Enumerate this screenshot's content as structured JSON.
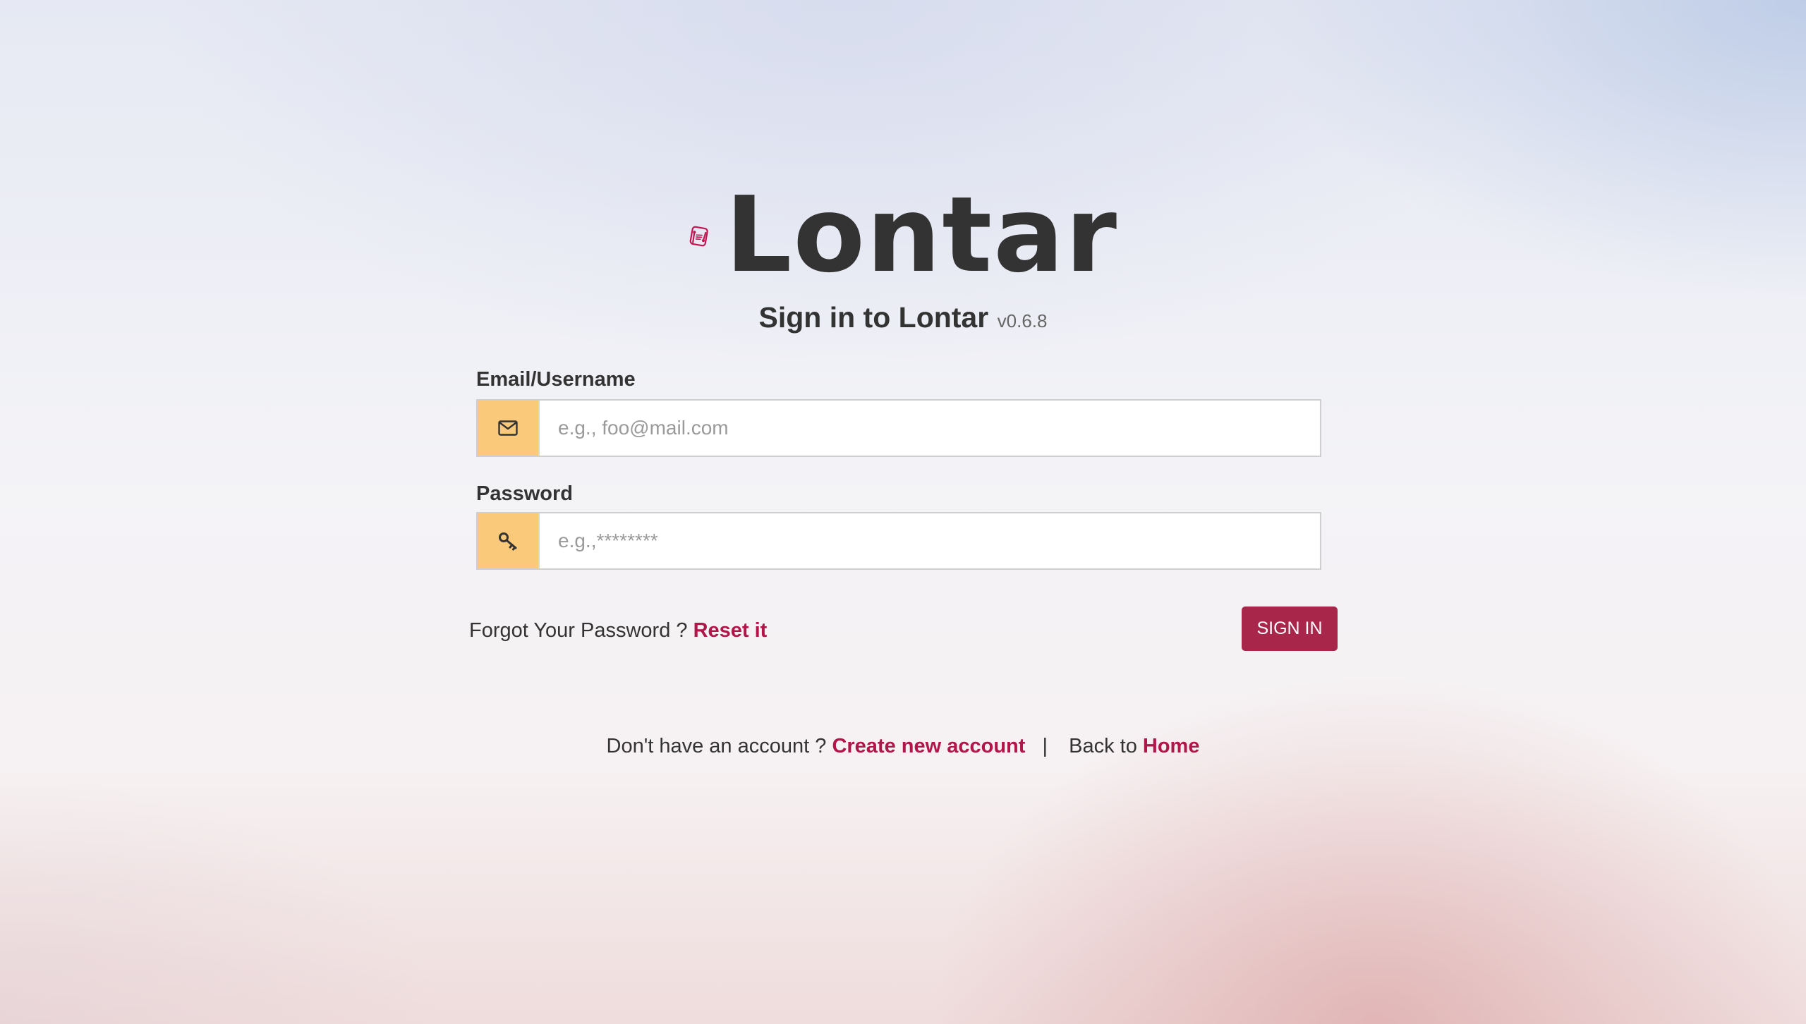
{
  "brand": {
    "name": "Lontar",
    "logo_color": "#c4124f",
    "icon": "document-logo-icon"
  },
  "heading": {
    "title": "Sign in to Lontar",
    "version": "v0.6.8"
  },
  "form": {
    "email": {
      "label": "Email/Username",
      "placeholder": "e.g., foo@mail.com",
      "value": "",
      "icon": "envelope-icon"
    },
    "password": {
      "label": "Password",
      "placeholder": "e.g.,********",
      "value": "",
      "icon": "key-icon"
    },
    "addon_color": "#fbc97a",
    "submit_label": "SIGN IN",
    "submit_color": "#a8264a"
  },
  "forgot": {
    "text": "Forgot Your Password ?",
    "link_label": "Reset it"
  },
  "footer": {
    "no_account_text": "Don't have an account ?",
    "create_link_label": "Create new account",
    "separator": "|",
    "back_text": "Back to",
    "home_link_label": "Home"
  },
  "colors": {
    "link": "#b2154a",
    "text": "#333333"
  }
}
